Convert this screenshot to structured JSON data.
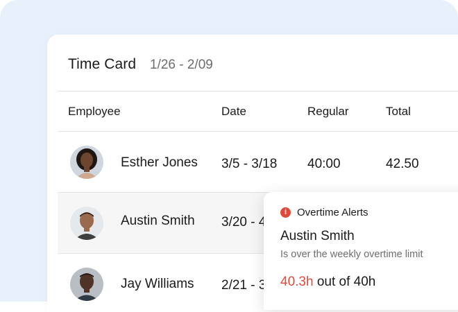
{
  "timecard": {
    "title": "Time Card",
    "date_range": "1/26 - 2/09"
  },
  "table": {
    "columns": [
      "Employee",
      "Date",
      "Regular",
      "Total"
    ],
    "rows": [
      {
        "name": "Esther Jones",
        "date": "3/5 - 3/18",
        "regular": "40:00",
        "total": "42.50"
      },
      {
        "name": "Austin Smith",
        "date": "3/20 - 4",
        "regular": "",
        "total": ""
      },
      {
        "name": "Jay Williams",
        "date": "2/21 - 3",
        "regular": "",
        "total": ""
      }
    ]
  },
  "alert": {
    "icon": "info-icon",
    "icon_glyph": "i",
    "title": "Overtime Alerts",
    "employee": "Austin Smith",
    "description": "Is over the weekly overtime limit",
    "hours_value": "40.3h",
    "hours_suffix": " out of 40h",
    "accent_color": "#e04a3c"
  },
  "colors": {
    "background_panel": "#e8f0fb",
    "highlight_row": "#f6f6f6"
  }
}
